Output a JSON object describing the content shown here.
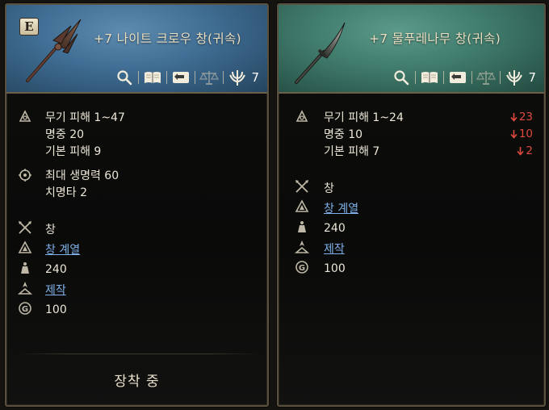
{
  "left_item": {
    "badge": "E",
    "title": "+7 나이트 크로우 창(귀속)",
    "header_color": "#3f6c92",
    "action_count": "7",
    "stat_lines": [
      {
        "label": "무기 피해 1~47",
        "icon": "attack-stat-icon"
      },
      {
        "label": "명중 20"
      },
      {
        "label": "기본 피해 9"
      },
      {
        "label": "최대 생명력 60",
        "icon": "target-stat-icon"
      },
      {
        "label": "치명타 2"
      }
    ],
    "info_lines": {
      "weapon_type": "창",
      "series_link": "창 계열",
      "weight": "240",
      "craft_link": "제작",
      "gold": "100"
    },
    "equipped_label": "장착 중"
  },
  "right_item": {
    "title": "+7 물푸레나무 창(귀속)",
    "header_color": "#3f7a6b",
    "action_count": "7",
    "stat_lines": [
      {
        "label": "무기 피해 1~24",
        "diff": "23"
      },
      {
        "label": "명중 10",
        "diff": "10"
      },
      {
        "label": "기본 피해 7",
        "diff": "2"
      }
    ],
    "info_lines": {
      "weapon_type": "창",
      "series_link": "창 계열",
      "weight": "240",
      "craft_link": "제작",
      "gold": "100"
    }
  },
  "icons": {
    "actions": [
      "search-icon",
      "book-icon",
      "return-icon",
      "scale-icon",
      "trident-icon"
    ],
    "info": [
      "crossed-spears-icon",
      "series-icon",
      "weight-icon",
      "craft-icon",
      "gold-coin-icon"
    ]
  },
  "colors": {
    "down_arrow": "#e0493e",
    "link": "#7fb2ea"
  }
}
